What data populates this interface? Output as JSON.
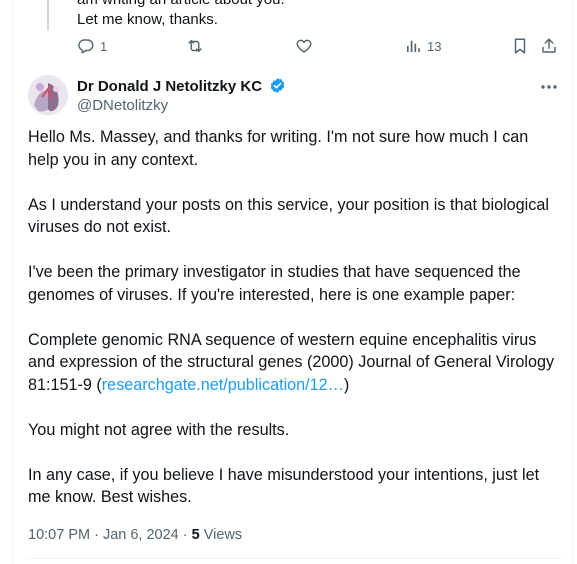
{
  "parent_tweet": {
    "text_line1": "am writing an article about you.",
    "text_line2": "Let me know, thanks.",
    "reply_count": "1",
    "views_count": "13"
  },
  "tweet": {
    "display_name": "Dr Donald J Netolitzky KC",
    "handle": "@DNetolitzky",
    "paragraphs": {
      "p1": "Hello Ms. Massey, and thanks for writing. I'm not sure how much I can help you in any context.",
      "p2": "As I understand your posts on this service, your position is that biological viruses do not exist.",
      "p3": "I've been the primary investigator in studies that have sequenced the genomes of viruses. If you're interested, here is one example paper:",
      "p4_text": "Complete genomic RNA sequence of western equine encephalitis virus and expression of the structural genes (2000) Journal of General Virology 81:151-9 (",
      "p4_link": "researchgate.net/publication/12…",
      "p4_close": ")",
      "p5": "You might not agree with the results.",
      "p6": "In any case, if you believe I have misunderstood your intentions, just let me know. Best wishes."
    },
    "timestamp": "10:07 PM · Jan 6, 2024",
    "separator": "·",
    "views_number": "5",
    "views_label": "Views"
  },
  "colors": {
    "link": "#1d9bf0",
    "secondary_text": "#536471",
    "verified_badge": "#1d9bf0"
  },
  "icons": [
    "reply-icon",
    "retweet-icon",
    "like-icon",
    "views-icon",
    "bookmark-icon",
    "share-icon",
    "verified-badge-icon",
    "more-options-icon"
  ]
}
